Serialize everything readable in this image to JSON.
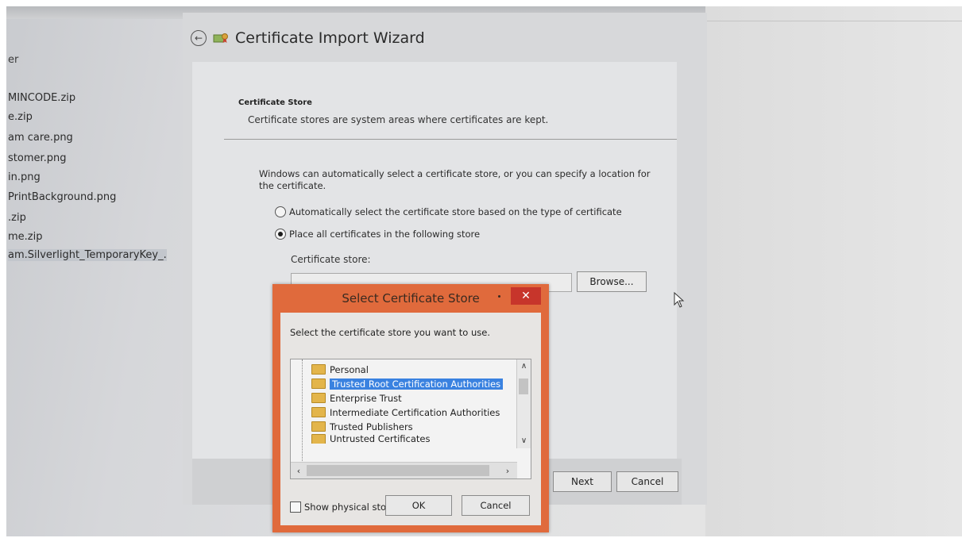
{
  "explorer": {
    "header": "er",
    "files": [
      "MINCODE.zip",
      "e.zip",
      "am care.png",
      "stomer.png",
      "in.png",
      "PrintBackground.png",
      ".zip",
      "me.zip",
      "am.Silverlight_TemporaryKey_..."
    ]
  },
  "wizard": {
    "title": "Certificate Import Wizard",
    "section_title": "Certificate Store",
    "section_desc": "Certificate stores are system areas where certificates are kept.",
    "intro": "Windows can automatically select a certificate store, or you can specify a location for the certificate.",
    "radio_auto": "Automatically select the certificate store based on the type of certificate",
    "radio_place": "Place all certificates in the following store",
    "store_label": "Certificate store:",
    "store_value": "",
    "browse_label": "Browse...",
    "next_label": "Next",
    "cancel_label": "Cancel"
  },
  "dialog": {
    "title": "Select Certificate Store",
    "close_label": "✕",
    "prompt": "Select the certificate store you want to use.",
    "stores": [
      "Personal",
      "Trusted Root Certification Authorities",
      "Enterprise Trust",
      "Intermediate Certification Authorities",
      "Trusted Publishers",
      "Untrusted Certificates"
    ],
    "selected_store": "Trusted Root Certification Authorities",
    "show_physical_label": "Show physical stores",
    "ok_label": "OK",
    "cancel_label": "Cancel"
  },
  "colors": {
    "dialog_frame": "#e06a3c",
    "close_button": "#c7352b",
    "selection": "#3a82e0",
    "folder": "#e3b54b"
  }
}
